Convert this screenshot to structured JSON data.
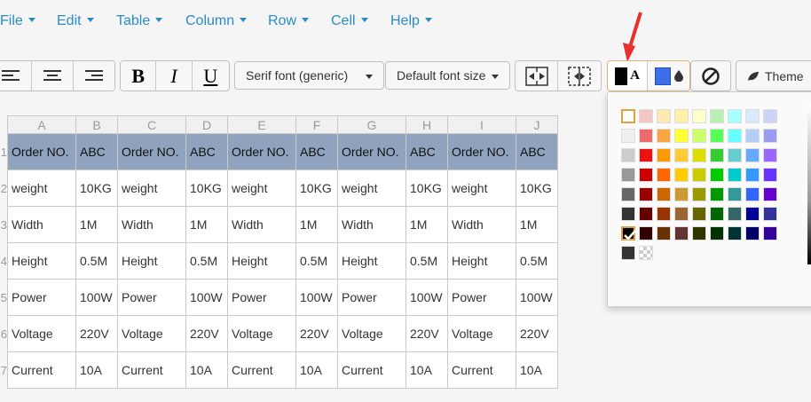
{
  "menu": [
    {
      "label": "File"
    },
    {
      "label": "Edit"
    },
    {
      "label": "Table"
    },
    {
      "label": "Column"
    },
    {
      "label": "Row"
    },
    {
      "label": "Cell"
    },
    {
      "label": "Help"
    }
  ],
  "toolbar": {
    "bold_label": "B",
    "italic_label": "I",
    "underline_label": "U",
    "font_family": "Serif font (generic)",
    "font_size": "Default font size",
    "text_color_glyph": "A",
    "theme_label": "Theme"
  },
  "columns": [
    "A",
    "B",
    "C",
    "D",
    "E",
    "F",
    "G",
    "H",
    "I",
    "J"
  ],
  "row_numbers": [
    "1",
    "2",
    "3",
    "4",
    "5",
    "6",
    "7"
  ],
  "rows": [
    [
      "Order NO.",
      "ABC",
      "Order NO.",
      "ABC",
      "Order NO.",
      "ABC",
      "Order NO.",
      "ABC",
      "Order NO.",
      "ABC"
    ],
    [
      "weight",
      "10KG",
      "weight",
      "10KG",
      "weight",
      "10KG",
      "weight",
      "10KG",
      "weight",
      "10KG"
    ],
    [
      "Width",
      "1M",
      "Width",
      "1M",
      "Width",
      "1M",
      "Width",
      "1M",
      "Width",
      "1M"
    ],
    [
      "Height",
      "0.5M",
      "Height",
      "0.5M",
      "Height",
      "0.5M",
      "Height",
      "0.5M",
      "Height",
      "0.5M"
    ],
    [
      "Power",
      "100W",
      "Power",
      "100W",
      "Power",
      "100W",
      "Power",
      "100W",
      "Power",
      "100W"
    ],
    [
      "Voltage",
      "220V",
      "Voltage",
      "220V",
      "Voltage",
      "220V",
      "Voltage",
      "220V",
      "Voltage",
      "220V"
    ],
    [
      "Current",
      "10A",
      "Current",
      "10A",
      "Current",
      "10A",
      "Current",
      "10A",
      "Current",
      "10A"
    ]
  ],
  "colors": {
    "menu_text": "#2a8bc9",
    "header_row": "#8fa3bf",
    "selected_text_color": "#000000",
    "selected_bg_color": "#3a6fe8",
    "annotation_arrow": "#e8312f"
  },
  "palette": [
    [
      "#ffffff",
      "#f4c7c3",
      "#fce8b2",
      "#fff2a8",
      "#ffffcc",
      "#b7f0b1",
      "#a8ffff",
      "#d9e8fb",
      "#cfd3f5"
    ],
    [
      "#eeeeee",
      "#f06b6b",
      "#f9a541",
      "#ffff33",
      "#ccff66",
      "#55ff55",
      "#66ffff",
      "#b4cef5",
      "#9b9bf0"
    ],
    [
      "#cccccc",
      "#ee1111",
      "#ff9900",
      "#ffcc33",
      "#dddd00",
      "#33cc33",
      "#66cccc",
      "#66aaff",
      "#9966ff"
    ],
    [
      "#999999",
      "#cc0000",
      "#ff6600",
      "#ffcc00",
      "#cccc00",
      "#00cc00",
      "#00cccc",
      "#3399ff",
      "#6633ff"
    ],
    [
      "#666666",
      "#990000",
      "#cc6600",
      "#cc9933",
      "#999900",
      "#009900",
      "#339999",
      "#3366ff",
      "#6600cc"
    ],
    [
      "#333333",
      "#660000",
      "#993300",
      "#996633",
      "#666600",
      "#006600",
      "#336666",
      "#000099",
      "#333399"
    ],
    [
      "#000000",
      "#330000",
      "#663300",
      "#663333",
      "#333300",
      "#003300",
      "#003333",
      "#000066",
      "#330099"
    ],
    [
      "#333333",
      "transparent"
    ]
  ]
}
